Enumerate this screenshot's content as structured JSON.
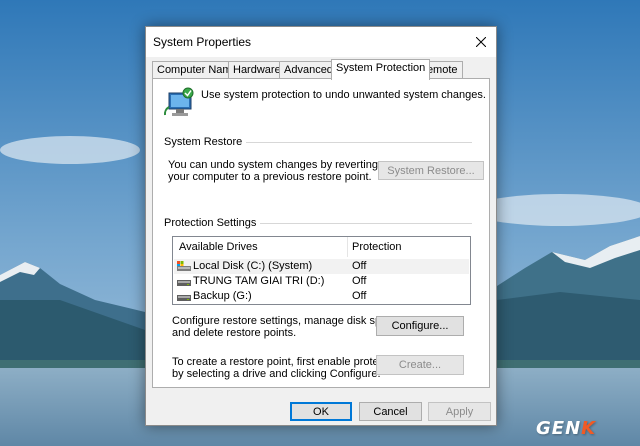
{
  "window": {
    "title": "System Properties"
  },
  "tabs": [
    {
      "label": "Computer Name",
      "active": false
    },
    {
      "label": "Hardware",
      "active": false
    },
    {
      "label": "Advanced",
      "active": false
    },
    {
      "label": "System Protection",
      "active": true
    },
    {
      "label": "Remote",
      "active": false
    }
  ],
  "intro": {
    "text": "Use system protection to undo unwanted system changes.",
    "icon": "system-protection-icon"
  },
  "system_restore": {
    "heading": "System Restore",
    "description_line1": "You can undo system changes by reverting",
    "description_line2": "your computer to a previous restore point.",
    "button_label": "System Restore..."
  },
  "protection": {
    "heading": "Protection Settings",
    "columns": {
      "drives": "Available Drives",
      "protection": "Protection"
    },
    "drives": [
      {
        "name": "Local Disk (C:) (System)",
        "protection": "Off",
        "icon": "system-drive-icon",
        "selected": true
      },
      {
        "name": "TRUNG TAM GIAI TRI  (D:)",
        "protection": "Off",
        "icon": "drive-icon",
        "selected": false
      },
      {
        "name": "Backup (G:)",
        "protection": "Off",
        "icon": "drive-icon",
        "selected": false
      }
    ],
    "configure_line1": "Configure restore settings, manage disk space,",
    "configure_line2": "and delete restore points.",
    "configure_button": "Configure...",
    "create_line1": "To create a restore point, first enable protection",
    "create_line2": "by selecting a drive and clicking Configure.",
    "create_button": "Create..."
  },
  "footer": {
    "ok": "OK",
    "cancel": "Cancel",
    "apply": "Apply"
  },
  "watermark": {
    "text_main": "GEN",
    "text_accent": "K"
  },
  "colors": {
    "accent": "#0078d7",
    "watermark_accent": "#f15a24"
  }
}
